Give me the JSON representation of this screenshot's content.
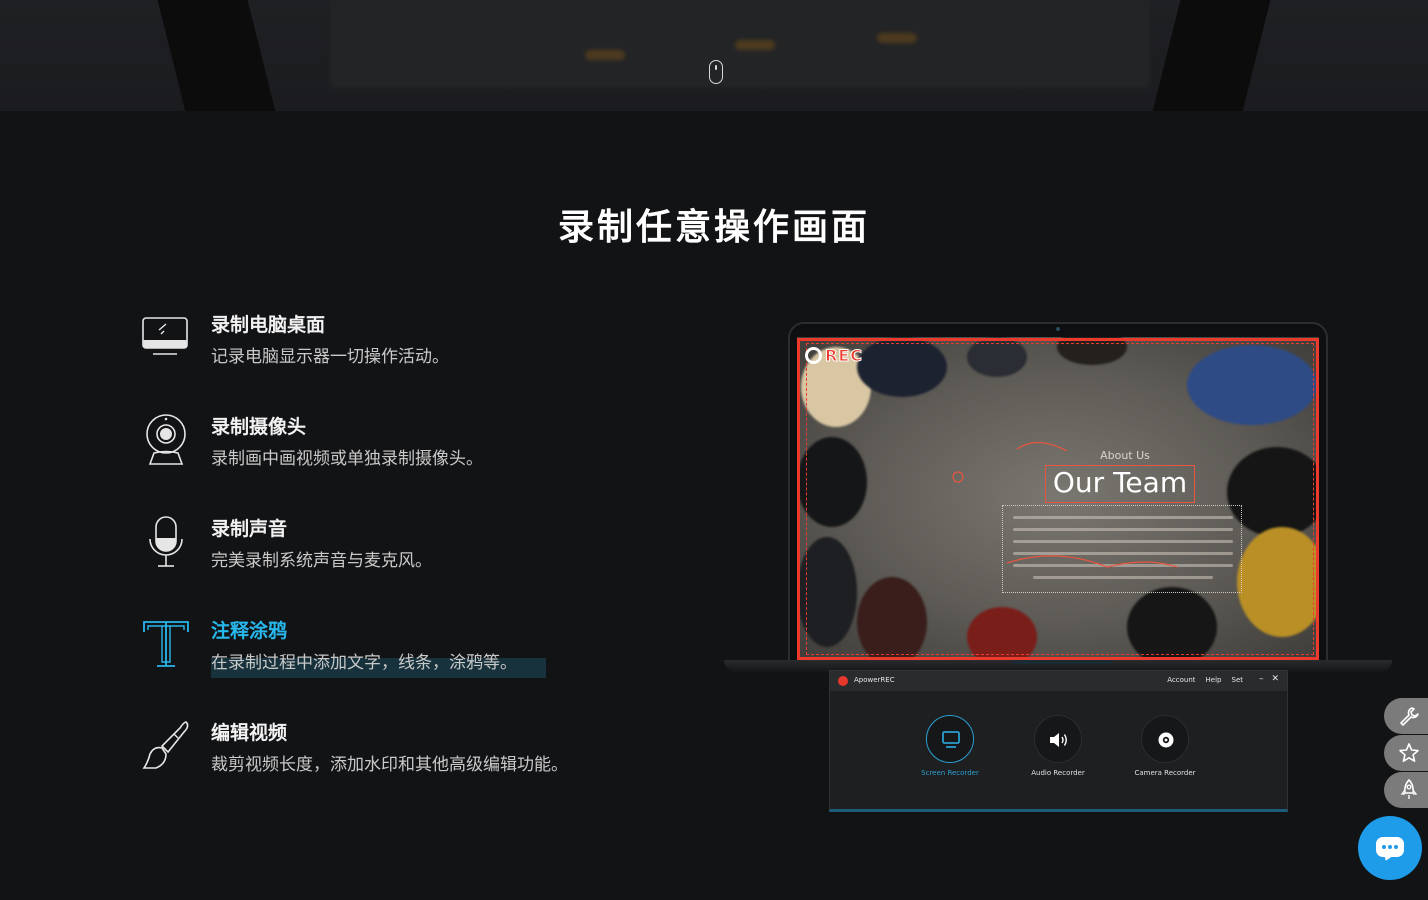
{
  "section": {
    "title": "录制任意操作画面"
  },
  "features": [
    {
      "title": "录制电脑桌面",
      "desc": "记录电脑显示器一切操作活动。",
      "icon": "desktop-monitor-icon"
    },
    {
      "title": "录制摄像头",
      "desc": "录制画中画视频或单独录制摄像头。",
      "icon": "webcam-icon"
    },
    {
      "title": "录制声音",
      "desc": "完美录制系统声音与麦克风。",
      "icon": "microphone-icon"
    },
    {
      "title": "注释涂鸦",
      "desc": "在录制过程中添加文字，线条，涂鸦等。",
      "icon": "text-annotation-icon",
      "active": true
    },
    {
      "title": "编辑视频",
      "desc": "裁剪视频长度，添加水印和其他高级编辑功能。",
      "icon": "paintbrush-icon"
    }
  ],
  "preview": {
    "rec_label": "REC",
    "about_label": "About Us",
    "heading": "Our Team"
  },
  "app_window": {
    "name": "ApowerREC",
    "menu": [
      "Account",
      "Help",
      "Set"
    ],
    "buttons": [
      {
        "label": "Screen Recorder",
        "active": true
      },
      {
        "label": "Audio Recorder"
      },
      {
        "label": "Camera Recorder"
      }
    ]
  },
  "side_tools": [
    "wrench-icon",
    "star-icon",
    "rocket-icon"
  ],
  "colors": {
    "accent": "#27b8ee",
    "rec_red": "#ee3a2d",
    "chat_blue": "#1e9be9",
    "background": "#121315"
  }
}
